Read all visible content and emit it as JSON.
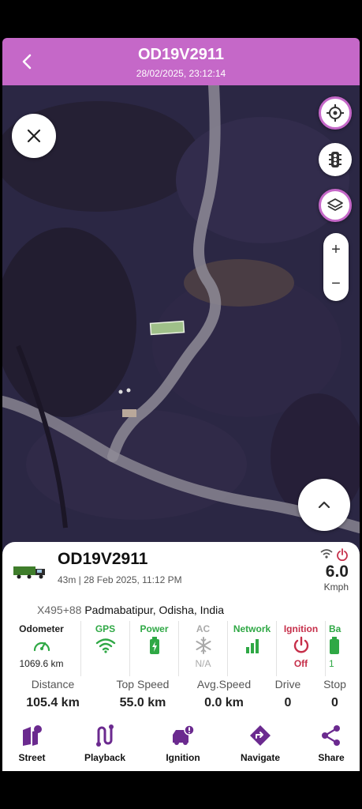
{
  "header": {
    "title": "OD19V2911",
    "subtitle": "28/02/2025, 23:12:14"
  },
  "colors": {
    "accent": "#c568c8",
    "green": "#2fa845",
    "red": "#c62f4a",
    "purple": "#6b2a8f"
  },
  "map_controls": {
    "close": "close-icon",
    "locate": "crosshair-icon",
    "traffic": "traffic-light-icon",
    "layers": "layers-icon",
    "zoom_in": "+",
    "zoom_out": "−",
    "expand": "chevron-up-icon"
  },
  "vehicle": {
    "name": "OD19V2911",
    "time": "43m | 28 Feb 2025, 11:12 PM",
    "speed": "6.0",
    "speed_unit": "Kmph",
    "address_code": "X495+88",
    "address_text": "Padmabatipur, Odisha, India"
  },
  "stats": [
    {
      "label": "Odometer",
      "value": "1069.6 km",
      "icon": "speedometer-icon"
    },
    {
      "label": "GPS",
      "value": "",
      "icon": "wifi-icon"
    },
    {
      "label": "Power",
      "value": "",
      "icon": "battery-icon"
    },
    {
      "label": "AC",
      "value": "N/A",
      "icon": "snowflake-icon"
    },
    {
      "label": "Network",
      "value": "",
      "icon": "signal-bars-icon"
    },
    {
      "label": "Ignition",
      "value": "Off",
      "icon": "power-icon"
    },
    {
      "label": "Ba",
      "value": "1",
      "icon": "battery-icon"
    }
  ],
  "metrics": [
    {
      "label": "Distance",
      "value": "105.4 km"
    },
    {
      "label": "Top Speed",
      "value": "55.0 km"
    },
    {
      "label": "Avg.Speed",
      "value": "0.0 km"
    },
    {
      "label": "Drive",
      "value": "0"
    },
    {
      "label": "Stop",
      "value": "0"
    }
  ],
  "nav": [
    {
      "label": "Street",
      "icon": "street-view-icon"
    },
    {
      "label": "Playback",
      "icon": "route-icon"
    },
    {
      "label": "Ignition",
      "icon": "ignition-alert-icon"
    },
    {
      "label": "Navigate",
      "icon": "navigate-icon"
    },
    {
      "label": "Share",
      "icon": "share-icon"
    }
  ]
}
